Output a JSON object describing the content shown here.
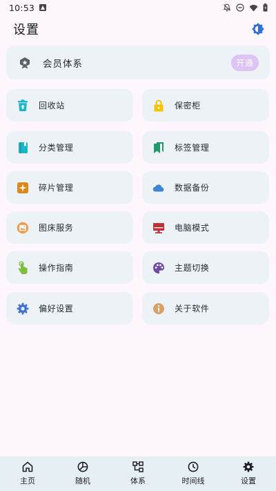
{
  "status_bar": {
    "time": "10:53",
    "icons": [
      "a-notification-icon",
      "mute-bell-icon",
      "do-not-disturb-icon",
      "wifi-icon",
      "battery-icon"
    ]
  },
  "header": {
    "title": "设置",
    "theme_icon": "brightness-icon"
  },
  "member": {
    "label": "会员体系",
    "button": "开通",
    "icon": "vip-badge-icon"
  },
  "tiles": [
    {
      "label": "回收站",
      "icon": "recycle-bin-icon",
      "color": "#1bb5c8"
    },
    {
      "label": "保密柜",
      "icon": "lock-icon",
      "color": "#f5c300"
    },
    {
      "label": "分类管理",
      "icon": "notebook-icon",
      "color": "#1bb5c8"
    },
    {
      "label": "标签管理",
      "icon": "bookmark-icon",
      "color": "#1f9a6b"
    },
    {
      "label": "碎片管理",
      "icon": "sparkle-icon",
      "color": "#d98a1a"
    },
    {
      "label": "数据备份",
      "icon": "cloud-icon",
      "color": "#3d86d6"
    },
    {
      "label": "图床服务",
      "icon": "image-icon",
      "color": "#f09a4a"
    },
    {
      "label": "电脑模式",
      "icon": "computer-icon",
      "color": "#c0303a"
    },
    {
      "label": "操作指南",
      "icon": "tap-hand-icon",
      "color": "#7dbe3c"
    },
    {
      "label": "主题切换",
      "icon": "palette-icon",
      "color": "#6e4aa8"
    },
    {
      "label": "偏好设置",
      "icon": "gear-icon",
      "color": "#3d6fd6"
    },
    {
      "label": "关于软件",
      "icon": "info-icon",
      "color": "#d8a06a"
    }
  ],
  "nav": [
    {
      "label": "主页",
      "icon": "home-icon"
    },
    {
      "label": "随机",
      "icon": "random-icon"
    },
    {
      "label": "体系",
      "icon": "hierarchy-icon"
    },
    {
      "label": "时间线",
      "icon": "clock-icon"
    },
    {
      "label": "设置",
      "icon": "gear-icon"
    }
  ]
}
